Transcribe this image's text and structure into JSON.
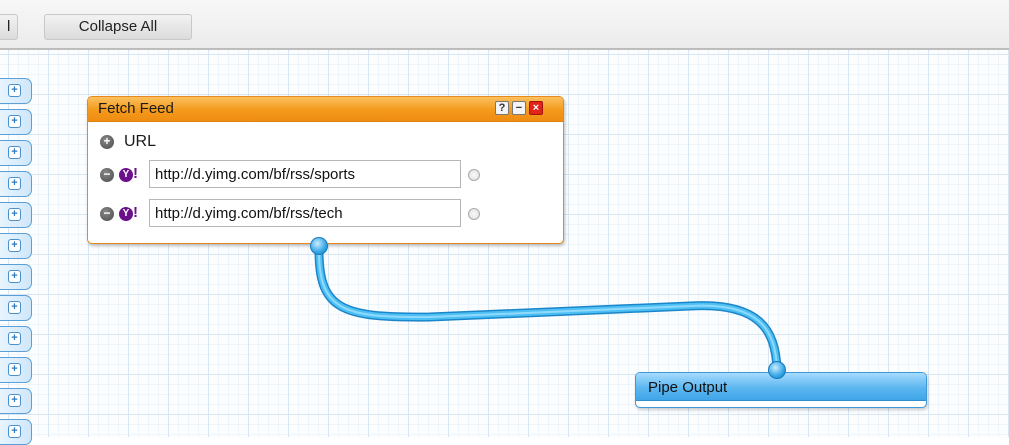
{
  "toolbar": {
    "partial_label": "l",
    "collapse_label": "Collapse All"
  },
  "left_rail": {
    "tab_icon": "plus-expand-icon",
    "tab_count": 12
  },
  "fetch_feed": {
    "title": "Fetch Feed",
    "field_label": "URL",
    "urls": [
      "http://d.yimg.com/bf/rss/sports",
      "http://d.yimg.com/bf/rss/tech"
    ],
    "header_buttons": [
      "help-icon",
      "minimize-icon",
      "close-icon"
    ],
    "accent_color": "#f39a1c"
  },
  "pipe_output": {
    "title": "Pipe Output",
    "accent_color": "#5cb7f0"
  },
  "wire": {
    "color": "#3aaeea"
  }
}
